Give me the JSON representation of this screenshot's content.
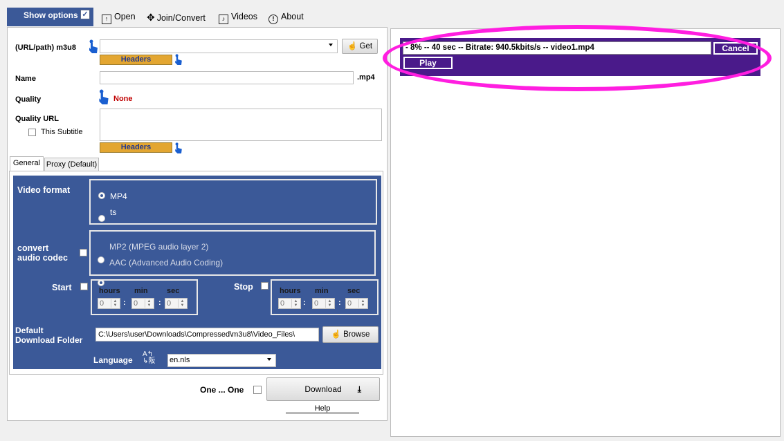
{
  "toolbar": {
    "show_options": "Show options",
    "show_options_checked": "✓",
    "open": "Open",
    "join_convert": "Join/Convert",
    "videos": "Videos",
    "about": "About"
  },
  "form": {
    "url_label": "(URL/path) m3u8",
    "url_value": "",
    "get_button": "Get",
    "headers_button": "Headers",
    "name_label": "Name",
    "name_value": "",
    "name_ext": ".mp4",
    "quality_label": "Quality",
    "quality_value": "None",
    "quality_url_label": "Quality URL",
    "this_subtitle_label": "This Subtitle",
    "headers_button_2": "Headers"
  },
  "tabs": [
    {
      "label": "General",
      "active": true
    },
    {
      "label": "Proxy (Default)",
      "active": false
    }
  ],
  "general": {
    "video_format_label": "Video format",
    "format_options": [
      {
        "label": "MP4",
        "selected": true
      },
      {
        "label": "ts",
        "selected": false
      }
    ],
    "convert_audio_label_1": "convert",
    "convert_audio_label_2": "audio codec",
    "audio_options": [
      {
        "label": "MP2 (MPEG audio layer 2)",
        "selected": false
      },
      {
        "label": "AAC (Advanced Audio Coding)",
        "selected": true
      }
    ],
    "start_label": "Start",
    "stop_label": "Stop",
    "time_headers": [
      "hours",
      "min",
      "sec"
    ],
    "start_values": [
      "0",
      "0",
      "0"
    ],
    "stop_values": [
      "0",
      "0",
      "0"
    ],
    "download_folder_label_1": "Default",
    "download_folder_label_2": "Download Folder",
    "download_folder_value": "C:\\Users\\user\\Downloads\\Compressed\\m3u8\\Video_Files\\",
    "browse_button": "Browse",
    "language_label": "Language",
    "language_value": "en.nls"
  },
  "footer": {
    "one_by_one_label": "One ... One",
    "download_button": "Download",
    "help_link": "Help"
  },
  "progress": {
    "status_text": "- 8% -- 40 sec -- Bitrate: 940.5kbits/s  -- video1.mp4",
    "cancel_button": "Cancel",
    "play_button": "Play"
  },
  "colors": {
    "accent_blue": "#3b5998",
    "headers_orange": "#e3a631",
    "progress_purple": "#4a1a8a",
    "highlight_magenta": "#ff1ee0",
    "quality_red": "#c00000"
  }
}
